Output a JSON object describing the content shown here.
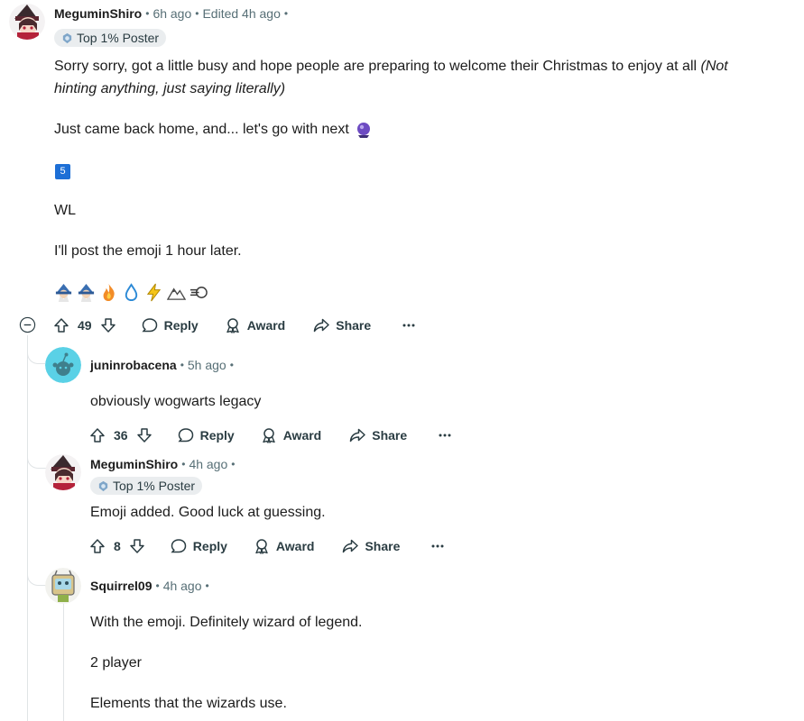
{
  "comments": [
    {
      "author": "MeguminShiro",
      "time": "6h ago",
      "edited": "Edited 4h ago",
      "flair": "Top 1% Poster",
      "text_line1": "Sorry sorry, got a little busy and hope people are preparing to welcome their Christmas to enjoy at all ",
      "text_line1_italic": "(Not",
      "text_line2_italic": "hinting anything, just saying literally)",
      "para2": "Just came back home, and... let's go with next",
      "keycap": "5",
      "para4": "WL",
      "para5": "I'll post the emoji 1 hour later.",
      "emoji_row": [
        "wizard-icon",
        "wizard-icon",
        "fire-icon",
        "water-drop-icon",
        "lightning-icon",
        "mountain-icon",
        "wind-icon"
      ],
      "votes": "49",
      "reply": "Reply",
      "award": "Award",
      "share": "Share"
    },
    {
      "author": "juninrobacena",
      "time": "5h ago",
      "text": "obviously wogwarts legacy",
      "votes": "36",
      "reply": "Reply",
      "award": "Award",
      "share": "Share"
    },
    {
      "author": "MeguminShiro",
      "time": "4h ago",
      "flair": "Top 1% Poster",
      "text": "Emoji added. Good luck at guessing.",
      "votes": "8",
      "reply": "Reply",
      "award": "Award",
      "share": "Share"
    },
    {
      "author": "Squirrel09",
      "time": "4h ago",
      "para1": "With the emoji. Definitely wizard of legend.",
      "para2": "2 player",
      "para3": "Elements that the wizards use."
    }
  ],
  "colors": {
    "text": "#1c1c1c",
    "meta": "#576f76",
    "line": "#e0e4e6",
    "flair_bg": "#eaedef",
    "keycap": "#1d6fd6"
  }
}
